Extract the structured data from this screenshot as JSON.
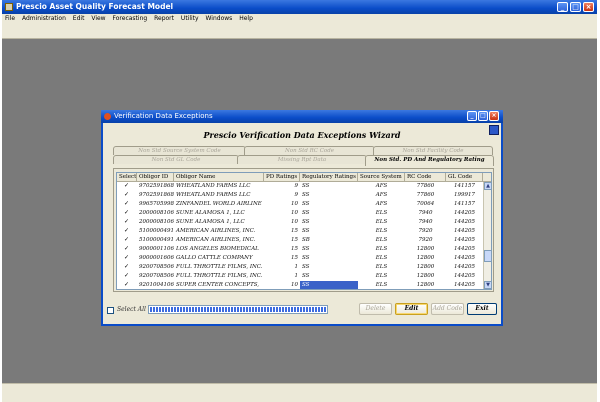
{
  "app": {
    "title": "Prescio Asset Quality Forecast Model",
    "menu": [
      "File",
      "Administration",
      "Edit",
      "View",
      "Forecasting",
      "Report",
      "Utility",
      "Windows",
      "Help"
    ],
    "caption_buttons": {
      "minimize": "_",
      "maximize": "□",
      "close": "×"
    }
  },
  "dialog": {
    "title": "Verification Data Exceptions",
    "wizard_title": "Prescio Verification Data Exceptions Wizard",
    "tabs_row1": [
      "Non Std Source System Code",
      "Non Std RC Code",
      "Non Std Facility Code"
    ],
    "tabs_row2": [
      "Non Std GL Code",
      "Missing Rpt Data",
      "Non Std. PD And Regulatory Rating"
    ],
    "active_tab": "Non Std. PD And Regulatory Rating",
    "columns": [
      "Select",
      "Obligor ID",
      "Obligor Name",
      "PD Ratings",
      "Regulatory Ratings",
      "Source System",
      "RC Code",
      "GL Code"
    ],
    "rows": [
      {
        "checked": true,
        "obligor_id": "9702591868",
        "obligor_name": "WHEATLAND FARMS LLC",
        "pd": "9",
        "reg": "SS",
        "source": "AFS",
        "rc": "77860",
        "gl": "141157"
      },
      {
        "checked": true,
        "obligor_id": "9702591868",
        "obligor_name": "WHEATLAND FARMS LLC",
        "pd": "9",
        "reg": "SS",
        "source": "AFS",
        "rc": "77860",
        "gl": "199917"
      },
      {
        "checked": true,
        "obligor_id": "9965705998",
        "obligor_name": "ZINFANDEL WORLD AIRLINE",
        "pd": "10",
        "reg": "SS",
        "source": "AFS",
        "rc": "70064",
        "gl": "141157"
      },
      {
        "checked": true,
        "obligor_id": "2000008106",
        "obligor_name": "SUNE ALAMOSA 1, LLC",
        "pd": "10",
        "reg": "SS",
        "source": "ELS",
        "rc": "7940",
        "gl": "144205"
      },
      {
        "checked": true,
        "obligor_id": "2000008106",
        "obligor_name": "SUNE ALAMOSA 1, LLC",
        "pd": "10",
        "reg": "SS",
        "source": "ELS",
        "rc": "7940",
        "gl": "144205"
      },
      {
        "checked": true,
        "obligor_id": "5100000491",
        "obligor_name": "AMERICAN AIRLINES, INC.",
        "pd": "15",
        "reg": "SS",
        "source": "ELS",
        "rc": "7920",
        "gl": "144205"
      },
      {
        "checked": true,
        "obligor_id": "5100000491",
        "obligor_name": "AMERICAN AIRLINES, INC.",
        "pd": "15",
        "reg": "SB",
        "source": "ELS",
        "rc": "7920",
        "gl": "144205"
      },
      {
        "checked": true,
        "obligor_id": "9000001106",
        "obligor_name": "LOS ANGELES BIOMEDICAL",
        "pd": "15",
        "reg": "SS",
        "source": "ELS",
        "rc": "12800",
        "gl": "144205"
      },
      {
        "checked": true,
        "obligor_id": "9000001606",
        "obligor_name": "GALLO CATTLE COMPANY",
        "pd": "15",
        "reg": "SS",
        "source": "ELS",
        "rc": "12800",
        "gl": "144205"
      },
      {
        "checked": true,
        "obligor_id": "9200708506",
        "obligor_name": "FULL THROTTLE FILMS, INC.",
        "pd": "1",
        "reg": "SS",
        "source": "ELS",
        "rc": "12800",
        "gl": "144205"
      },
      {
        "checked": true,
        "obligor_id": "9200708506",
        "obligor_name": "FULL THROTTLE FILMS, INC.",
        "pd": "1",
        "reg": "SS",
        "source": "ELS",
        "rc": "12800",
        "gl": "144205"
      },
      {
        "checked": true,
        "obligor_id": "9201004106",
        "obligor_name": "SUPER CENTER CONCEPTS,",
        "pd": "10",
        "reg": "SS",
        "source": "ELS",
        "rc": "12800",
        "gl": "144205"
      }
    ],
    "scroll": {
      "up": "▲",
      "down": "▼"
    },
    "select_all_label": "Select All",
    "progress": 1.0,
    "buttons": {
      "delete": "Delete",
      "edit": "Edit",
      "add_code": "Add Code",
      "exit": "Exit"
    }
  },
  "colors": {
    "title_bar": "#0a4cc8",
    "desktop": "#7a7a7a",
    "dialog_face": "#ece9d8",
    "selection": "#3a62c8"
  }
}
